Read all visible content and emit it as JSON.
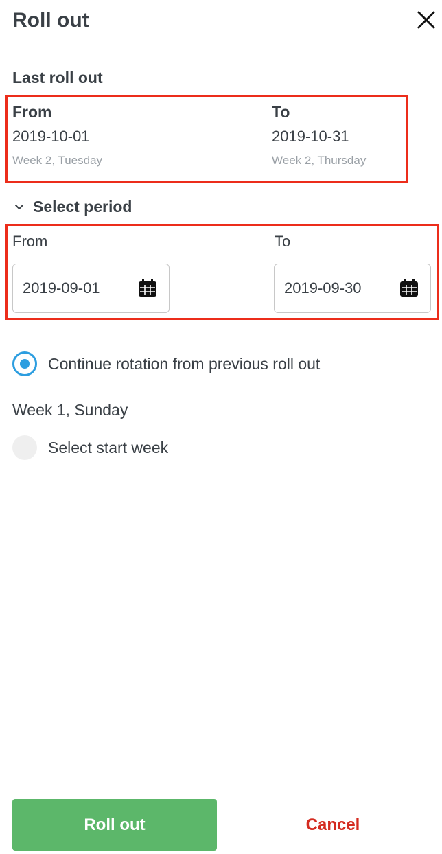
{
  "header": {
    "title": "Roll out",
    "close_icon": "close-icon"
  },
  "last_roll_out": {
    "heading": "Last roll out",
    "from": {
      "label": "From",
      "date": "2019-10-01",
      "week": "Week 2, Tuesday"
    },
    "to": {
      "label": "To",
      "date": "2019-10-31",
      "week": "Week 2, Thursday"
    }
  },
  "select_period": {
    "label": "Select period",
    "icon": "chevron-down-icon",
    "from": {
      "label": "From",
      "value": "2019-09-01",
      "icon": "calendar-icon"
    },
    "to": {
      "label": "To",
      "value": "2019-09-30",
      "icon": "calendar-icon"
    }
  },
  "rotation": {
    "continue_label": "Continue rotation from previous roll out",
    "continue_selected": true,
    "week_text": "Week 1, Sunday",
    "select_start_label": "Select start week",
    "select_start_selected": false
  },
  "actions": {
    "roll_out_label": "Roll out",
    "cancel_label": "Cancel"
  },
  "colors": {
    "primary": "#5cb76a",
    "danger": "#d42b20",
    "radio_accent": "#2d9ee0",
    "highlight": "#ec2d1b"
  }
}
